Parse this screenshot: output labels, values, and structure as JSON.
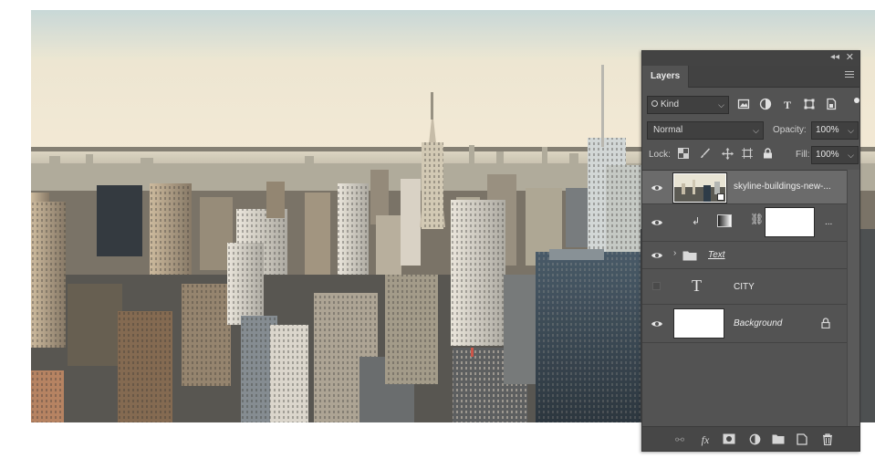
{
  "panel": {
    "tab_label": "Layers",
    "filter": {
      "kind_label": "Kind"
    },
    "blend_mode": "Normal",
    "opacity_label": "Opacity:",
    "opacity_value": "100%",
    "lock_label": "Lock:",
    "fill_label": "Fill:",
    "fill_value": "100%"
  },
  "layers": [
    {
      "name": "skyline-buildings-new-...",
      "visible": true,
      "selected": true,
      "type": "smart-object"
    },
    {
      "name": "...",
      "visible": true,
      "type": "adjustment-clipped"
    },
    {
      "name": "Text",
      "visible": true,
      "type": "group"
    },
    {
      "name": "CITY",
      "visible": false,
      "type": "text",
      "glyph": "T"
    },
    {
      "name": "Background",
      "visible": true,
      "type": "background",
      "locked": true
    }
  ],
  "colors": {
    "panel_bg": "#535353",
    "selected_row": "#6b6b6b",
    "text": "#ececec"
  }
}
